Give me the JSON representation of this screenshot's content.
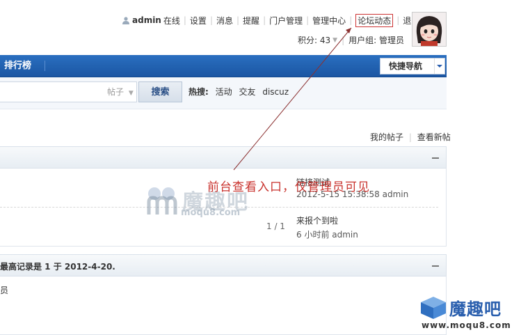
{
  "userbar": {
    "username": "admin",
    "status": "在线",
    "links": [
      "设置",
      "消息",
      "提醒",
      "门户管理",
      "管理中心"
    ],
    "highlighted": "论坛动态",
    "logout": "退出"
  },
  "meta": {
    "points_label": "积分: 43",
    "usergroup": "用户组: 管理员"
  },
  "nav": {
    "item": "排行榜",
    "quicknav_label": "快捷导航"
  },
  "search": {
    "type": "帖子",
    "button": "搜索",
    "hot_label": "热搜:",
    "hot_terms": [
      "活动",
      "交友",
      "discuz"
    ]
  },
  "sections": {
    "links_right": [
      "我的帖子",
      "查看新帖"
    ],
    "annotation": "前台查看入口，仅管理员可见",
    "posts": [
      {
        "title": "链接测试",
        "sub": "2012-5-15 15:38:58 admin"
      },
      {
        "title": "来报个到啦",
        "sub": "6 小时前 admin"
      }
    ],
    "pager": "1 / 1",
    "record_text": "最高记录是 1 于 2012-4-20.",
    "row_fragment": "员"
  },
  "watermark": {
    "center_text": "魔趣吧",
    "center_url": "moqu8.com",
    "corner_text": "魔趣吧",
    "corner_url": "www.moqu8.com"
  },
  "colors": {
    "nav_blue": "#1b56a3",
    "annotation_red": "#c9322d",
    "watermark_blue": "#2a5fae"
  }
}
